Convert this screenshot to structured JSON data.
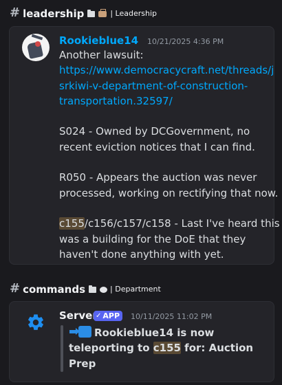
{
  "channel1": {
    "name": "leadership",
    "category_label": "| Leadership",
    "message": {
      "username": "Rookieblue14",
      "timestamp": "10/21/2025 4:36 PM",
      "lines": [
        "Another lawsuit:",
        "https://www.democracycraft.net/threads/j",
        "srkiwi-v-department-of-construction-",
        "transportation.32597/",
        "",
        "S024 - Owned by DCGovernment, no",
        "recent eviction notices that I can find.",
        "",
        "R050 - Appears the auction was never",
        "processed, working on rectifying that now.",
        "",
        "c155",
        "was a building for the DoE that they",
        "haven't done anything with yet."
      ],
      "line_c155_rest": "/c156/c157/c158 - Last I've heard this"
    }
  },
  "channel2": {
    "name": "commands",
    "category_label": "| Department",
    "message": {
      "username": "Server",
      "badge": "APP",
      "timestamp": "10/11/2025 11:02 PM",
      "quote": {
        "line1": "Rookieblue14 is now",
        "line2_pre": "teleporting to ",
        "line2_hl": "c155",
        "line2_post": " for: Auction",
        "line3": "Prep"
      }
    }
  },
  "colors": {
    "background": "#1a1a1e",
    "card": "#242429",
    "username_user": "#00a8fc",
    "username_bot": "#f2f3f5",
    "link": "#00a8fc",
    "app_badge": "#5865f2",
    "highlight": "#5a4a34",
    "gear": "#1e8ef0"
  },
  "icons": {
    "channel_hash": "hashtag-thread-icon",
    "folder": "folder-icon",
    "briefcase": "briefcase-icon",
    "speech": "speech-bubble-icon",
    "gear": "gear-icon",
    "teleport": "right-arrow-emoji-icon"
  }
}
